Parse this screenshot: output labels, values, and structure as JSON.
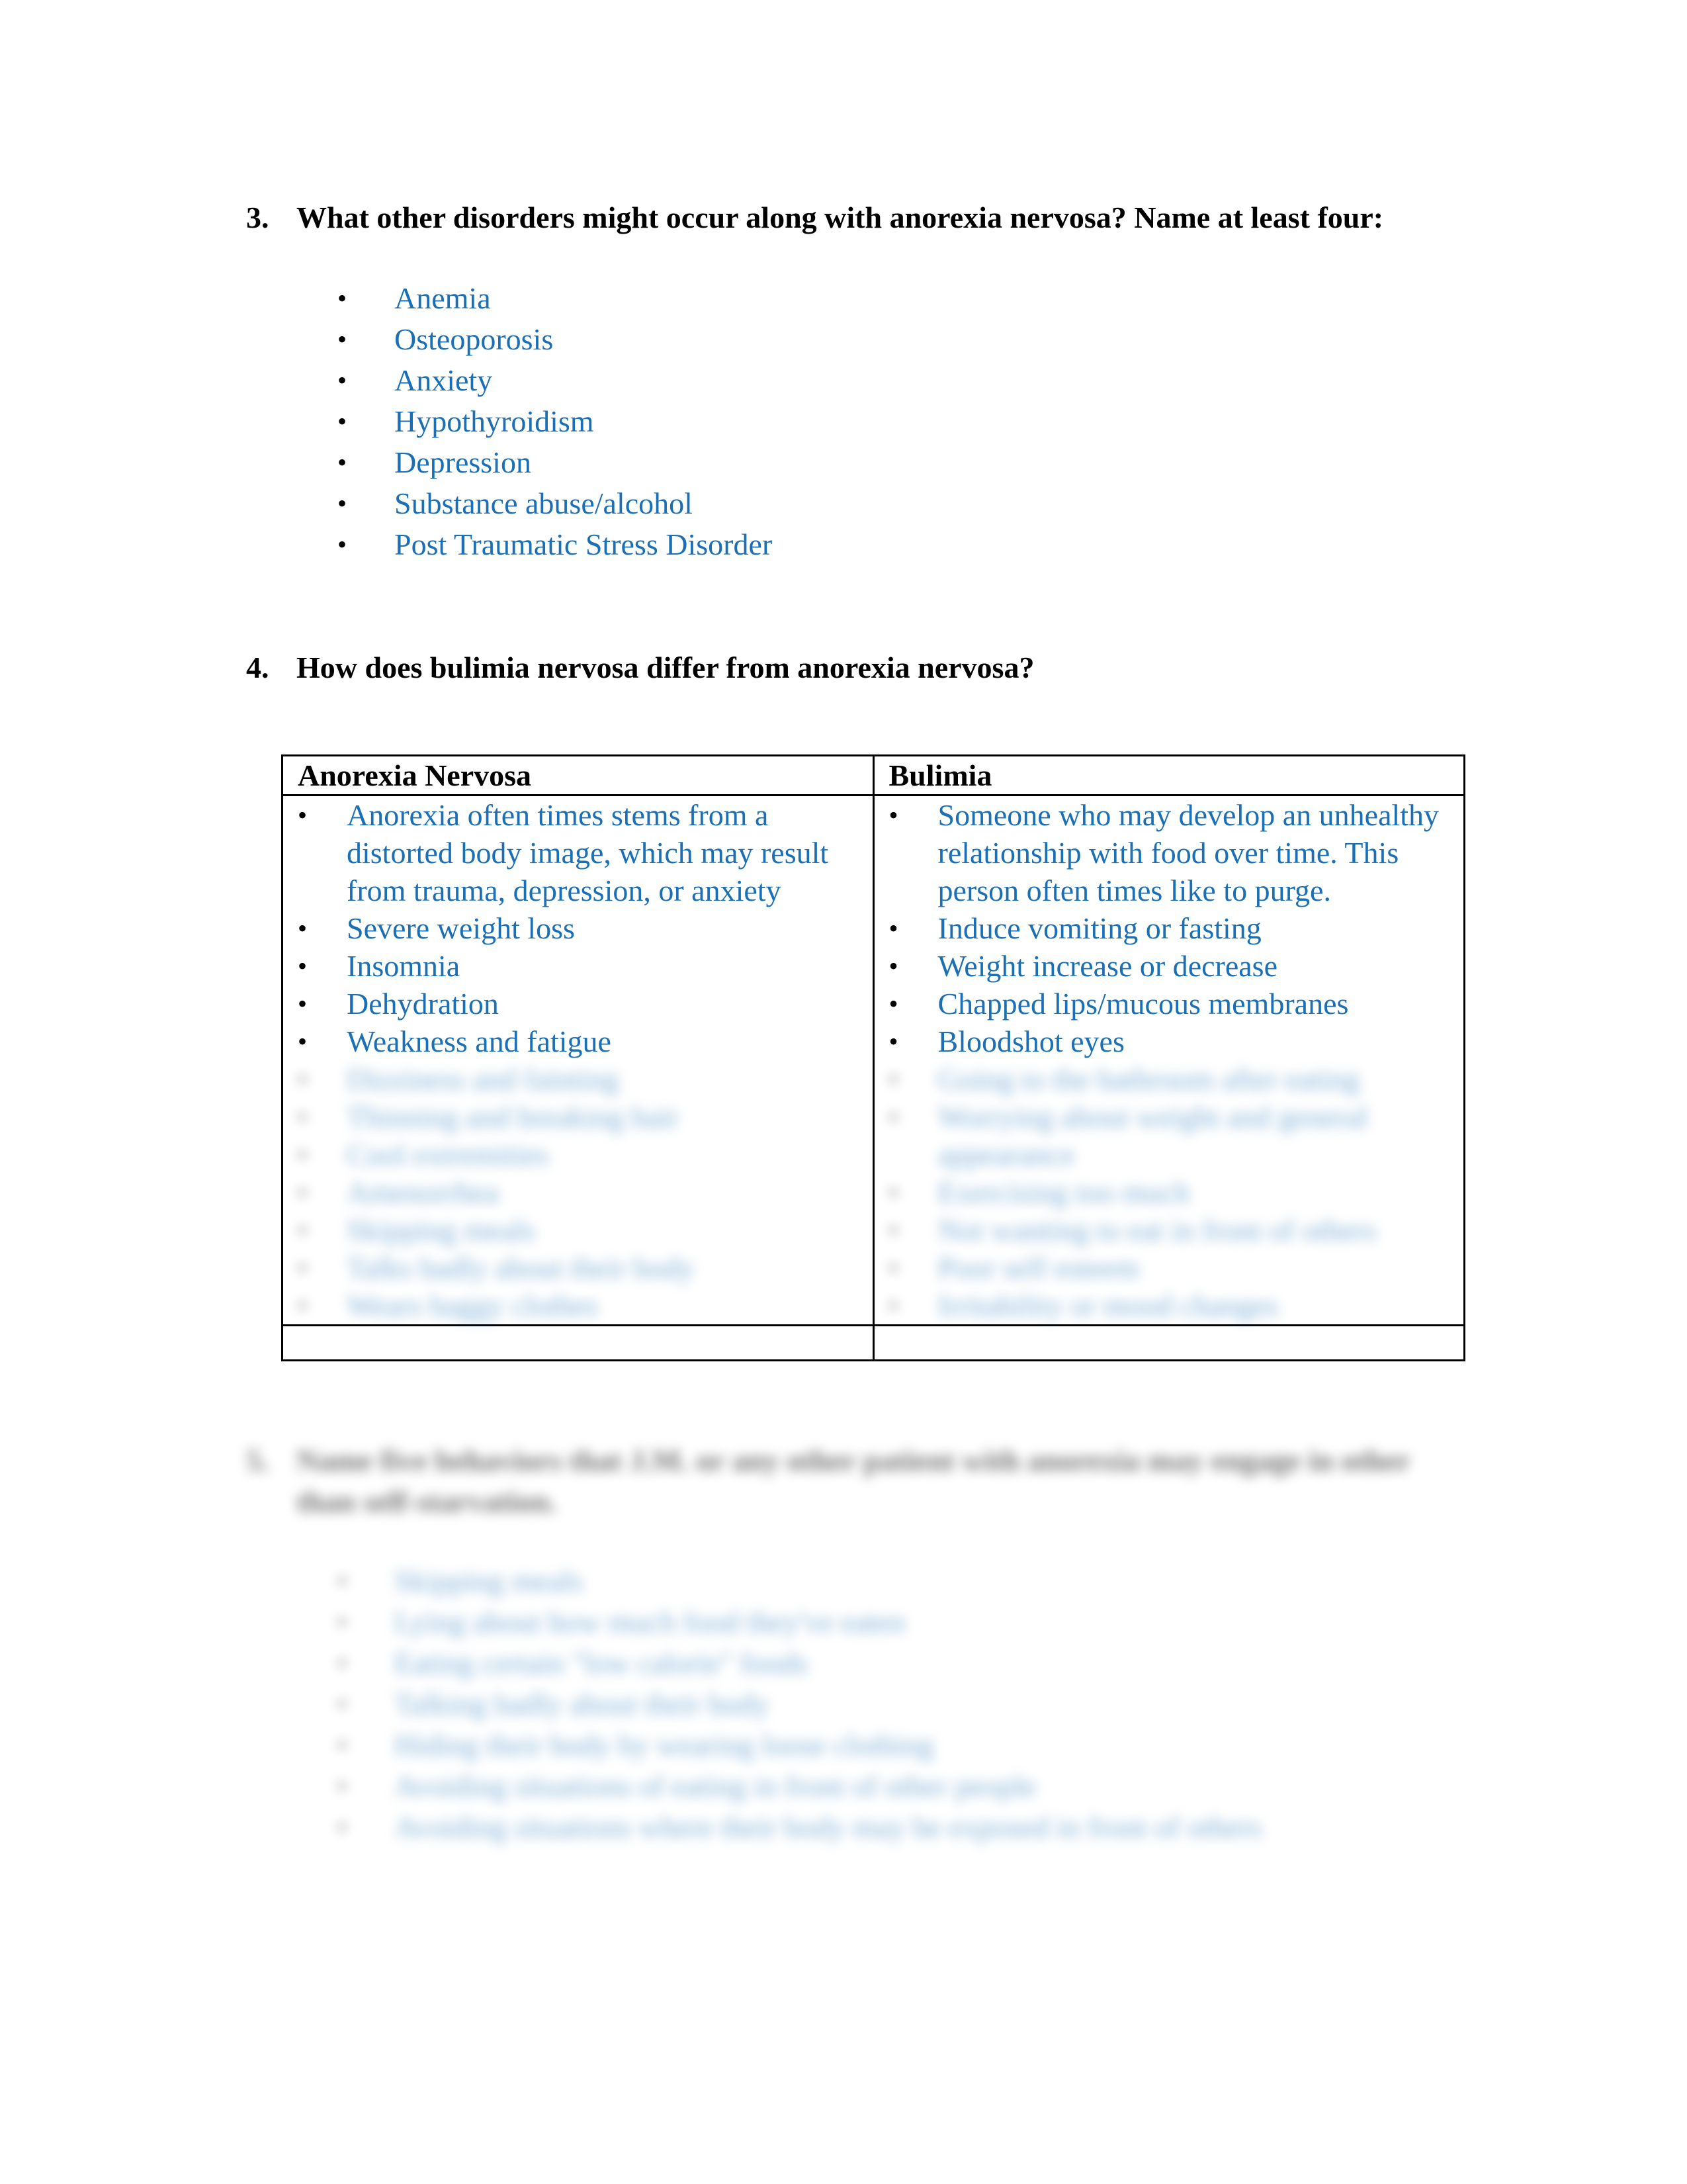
{
  "question3": {
    "number": "3.",
    "text": "What other disorders might occur along with anorexia nervosa? Name at least four:",
    "answers": [
      "Anemia",
      "Osteoporosis",
      "Anxiety",
      "Hypothyroidism",
      "Depression",
      "Substance abuse/alcohol",
      "Post Traumatic Stress Disorder"
    ]
  },
  "question4": {
    "number": "4.",
    "text": "How does bulimia nervosa differ from anorexia nervosa?",
    "table": {
      "headers": [
        "Anorexia Nervosa",
        "Bulimia"
      ],
      "anorexia_items": [
        "Anorexia often times stems from a distorted body image, which may result from trauma, depression, or anxiety",
        "Severe weight loss",
        "Insomnia",
        "Dehydration",
        "Weakness and fatigue"
      ],
      "bulimia_items": [
        "Someone who may develop an unhealthy relationship with food over time. This person often times like to purge.",
        "Induce vomiting or fasting",
        "Weight increase or decrease",
        "Chapped lips/mucous membranes",
        "Bloodshot eyes"
      ],
      "anorexia_blurred_items": [
        "Dizziness and fainting",
        "Thinning and breaking hair",
        "Cool extremities",
        "Amenorrhea",
        "Skipping meals",
        "Talks badly about their body",
        "Wears baggy clothes"
      ],
      "bulimia_blurred_items": [
        "Going to the bathroom after eating",
        "Worrying about weight and general appearance",
        "Exercising too much",
        "Not wanting to eat in front of others",
        "Poor self esteem",
        "Irritability or mood changes"
      ]
    }
  },
  "question5_blurred": {
    "number": "5.",
    "text": "Name five behaviors that J.M. or any other patient with anorexia may engage in other than self-starvation.",
    "answers": [
      "Skipping meals",
      "Lying about how much food they've eaten",
      "Eating certain \"low calorie\" foods",
      "Talking badly about their body",
      "Hiding their body by wearing loose clothing",
      "Avoiding situations of eating in front of other people",
      "Avoiding situations where their body may be exposed in front of others"
    ]
  },
  "bullet_glyph": "•",
  "colors": {
    "answer_text": "#1a6fb5",
    "question_text": "#000000"
  }
}
